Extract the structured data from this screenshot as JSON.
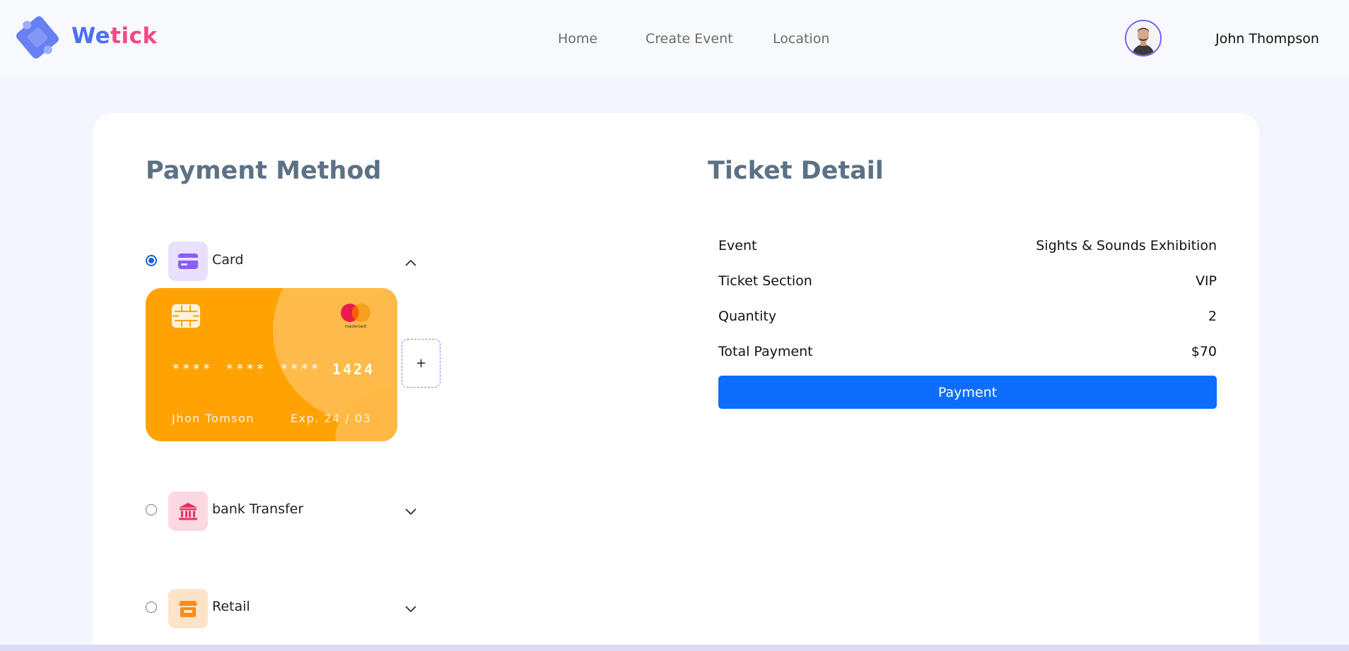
{
  "header": {
    "brand": {
      "part1": "We",
      "part2": "tick"
    },
    "nav": [
      {
        "label": "Home"
      },
      {
        "label": "Create Event"
      },
      {
        "label": "Location"
      }
    ],
    "user": {
      "name": "John Thompson"
    }
  },
  "payment": {
    "title": "Payment Method",
    "options": [
      {
        "label": "Card",
        "selected": true,
        "expanded": true,
        "icon": "credit-card-icon",
        "icon_bg": "#e9e0fd",
        "icon_color": "#8b5cf6"
      },
      {
        "label": "bank Transfer",
        "selected": false,
        "expanded": false,
        "icon": "bank-icon",
        "icon_bg": "#fcd9e2",
        "icon_color": "#ea2f61"
      },
      {
        "label": "Retail",
        "selected": false,
        "expanded": false,
        "icon": "store-icon",
        "icon_bg": "#fde3c8",
        "icon_color": "#fb8a1a"
      }
    ],
    "card": {
      "groups": [
        "****",
        "****",
        "****"
      ],
      "last4": "1424",
      "holder": "Jhon Tomson",
      "expiry": "Exp. 24 / 03",
      "network": "mastercard",
      "color": "#ffa202"
    },
    "add_card_label": "+"
  },
  "ticket": {
    "title": "Ticket Detail",
    "rows": [
      {
        "label": "Event",
        "value": "Sights & Sounds Exhibition"
      },
      {
        "label": "Ticket Section",
        "value": "VIP"
      },
      {
        "label": "Quantity",
        "value": "2"
      },
      {
        "label": "Total Payment",
        "value": "$70"
      }
    ],
    "button_label": "Payment",
    "button_color": "#0d6efd"
  }
}
